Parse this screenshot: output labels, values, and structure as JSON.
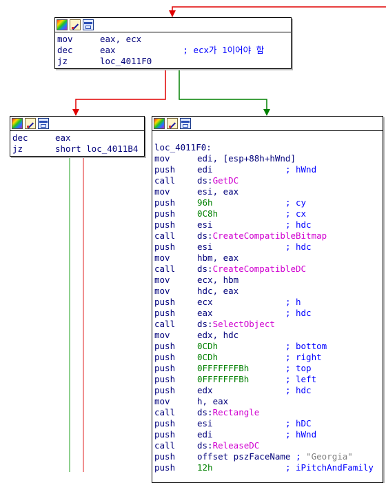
{
  "colors": {
    "edge_true": "#008000",
    "edge_false": "#e00000",
    "edge_true_faded": "#8fd08f",
    "edge_false_faded": "#f09090",
    "mnemonic": "#00007a",
    "number": "#008000",
    "api_name": "#d000d0",
    "comment": "#0000ff",
    "string": "#808080"
  },
  "header_icons": [
    "palette-icon",
    "edit-icon",
    "graph-icon"
  ],
  "blocks": {
    "top": {
      "lines": [
        {
          "mn": "mov",
          "op": "eax, ecx"
        },
        {
          "mn": "dec",
          "op": "eax",
          "pad": "             ",
          "cmt": "; ecx가 1이어야 함"
        },
        {
          "mn": "jz",
          "op": "loc_4011F0"
        }
      ]
    },
    "left": {
      "lines": [
        {
          "mn": "dec",
          "op": "eax"
        },
        {
          "mn": "jz",
          "op": "short loc_4011B4"
        }
      ]
    },
    "right": {
      "label": "loc_4011F0:",
      "lines": [
        {
          "mn": "mov",
          "op": "edi, [esp+88h+hWnd]"
        },
        {
          "mn": "push",
          "op": "edi",
          "pad": "              ",
          "cmt": "; hWnd"
        },
        {
          "mn": "call",
          "op": "ds:",
          "api": "GetDC"
        },
        {
          "mn": "mov",
          "op": "esi, eax"
        },
        {
          "mn": "push",
          "num": "96h",
          "pad": "              ",
          "cmt": "; cy"
        },
        {
          "mn": "push",
          "num": "0C8h",
          "pad": "             ",
          "cmt": "; cx"
        },
        {
          "mn": "push",
          "op": "esi",
          "pad": "              ",
          "cmt": "; hdc"
        },
        {
          "mn": "call",
          "op": "ds:",
          "api": "CreateCompatibleBitmap"
        },
        {
          "mn": "push",
          "op": "esi",
          "pad": "              ",
          "cmt": "; hdc"
        },
        {
          "mn": "mov",
          "op": "hbm, eax"
        },
        {
          "mn": "call",
          "op": "ds:",
          "api": "CreateCompatibleDC"
        },
        {
          "mn": "mov",
          "op": "ecx, hbm"
        },
        {
          "mn": "mov",
          "op": "hdc, eax"
        },
        {
          "mn": "push",
          "op": "ecx",
          "pad": "              ",
          "cmt": "; h"
        },
        {
          "mn": "push",
          "op": "eax",
          "pad": "              ",
          "cmt": "; hdc"
        },
        {
          "mn": "call",
          "op": "ds:",
          "api": "SelectObject"
        },
        {
          "mn": "mov",
          "op": "edx, hdc"
        },
        {
          "mn": "push",
          "num": "0CDh",
          "pad": "             ",
          "cmt": "; bottom"
        },
        {
          "mn": "push",
          "num": "0CDh",
          "pad": "             ",
          "cmt": "; right"
        },
        {
          "mn": "push",
          "num": "0FFFFFFFBh",
          "pad": "       ",
          "cmt": "; top"
        },
        {
          "mn": "push",
          "num": "0FFFFFFFBh",
          "pad": "       ",
          "cmt": "; left"
        },
        {
          "mn": "push",
          "op": "edx",
          "pad": "              ",
          "cmt": "; hdc"
        },
        {
          "mn": "mov",
          "op": "h, eax"
        },
        {
          "mn": "call",
          "op": "ds:",
          "api": "Rectangle"
        },
        {
          "mn": "push",
          "op": "esi",
          "pad": "              ",
          "cmt": "; hDC"
        },
        {
          "mn": "push",
          "op": "edi",
          "pad": "              ",
          "cmt": "; hWnd"
        },
        {
          "mn": "call",
          "op": "ds:",
          "api": "ReleaseDC"
        },
        {
          "mn": "push",
          "op": "offset pszFaceName",
          "pad": " ",
          "cmt": "; ",
          "str": "\"Georgia\""
        },
        {
          "mn": "push",
          "num": "12h",
          "pad": "              ",
          "cmt": "; iPitchAndFamily"
        }
      ]
    }
  }
}
